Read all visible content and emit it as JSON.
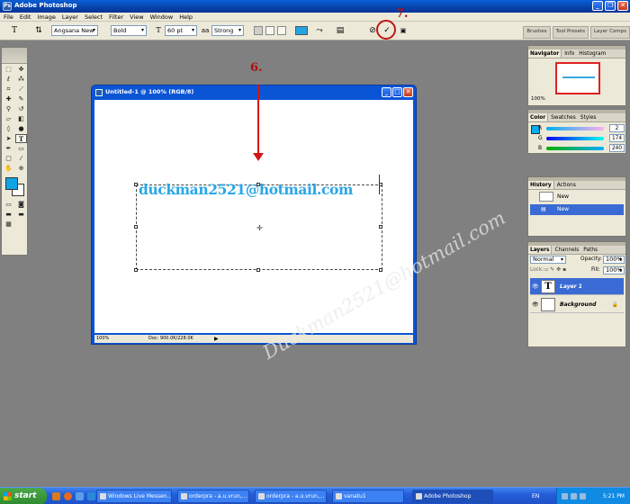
{
  "app": {
    "title": "Adobe Photoshop"
  },
  "menu": [
    "File",
    "Edit",
    "Image",
    "Layer",
    "Select",
    "Filter",
    "View",
    "Window",
    "Help"
  ],
  "options": {
    "font_family": "Angsana New",
    "font_style": "Bold",
    "font_size": "60 pt",
    "antialias": "Strong",
    "text_color": "#23a5e2",
    "palette_tabs": [
      "Brushes",
      "Tool Presets",
      "Layer Comps"
    ]
  },
  "annotations": {
    "step6": "6.",
    "step7": "7."
  },
  "document": {
    "title": "Untitled-1 @ 100% (RGB/8)",
    "text": "duckman2521@hotmail.com",
    "zoom": "100%",
    "doc_size": "Doc: 900.0K/228.0K"
  },
  "navigator": {
    "tabs": [
      "Navigator",
      "Info",
      "Histogram"
    ],
    "zoom": "100%"
  },
  "color_panel": {
    "tabs": [
      "Color",
      "Swatches",
      "Styles"
    ],
    "r_label": "R",
    "g_label": "G",
    "b_label": "B",
    "r": "2",
    "g": "174",
    "b": "240",
    "swatch": "#02aef0"
  },
  "history_panel": {
    "tabs": [
      "History",
      "Actions"
    ],
    "items": [
      "New",
      "New"
    ]
  },
  "layers_panel": {
    "tabs": [
      "Layers",
      "Channels",
      "Paths"
    ],
    "blend_mode": "Normal",
    "opacity_label": "Opacity:",
    "opacity": "100%",
    "lock_label": "Lock:",
    "fill_label": "Fill:",
    "fill": "100%",
    "layers": [
      {
        "name": "Layer 1",
        "thumb": "T"
      },
      {
        "name": "Background",
        "thumb": ""
      }
    ]
  },
  "watermark": "Duckman2521@hotmail.com",
  "taskbar": {
    "start": "start",
    "tasks": [
      "Windows Live Messen...",
      "orderpra - a.u.vrun,...",
      "orderpra - a.u.vrun,...",
      "vanatu1",
      "Adobe Photoshop"
    ],
    "lang": "EN",
    "clock": "5:21 PM"
  }
}
